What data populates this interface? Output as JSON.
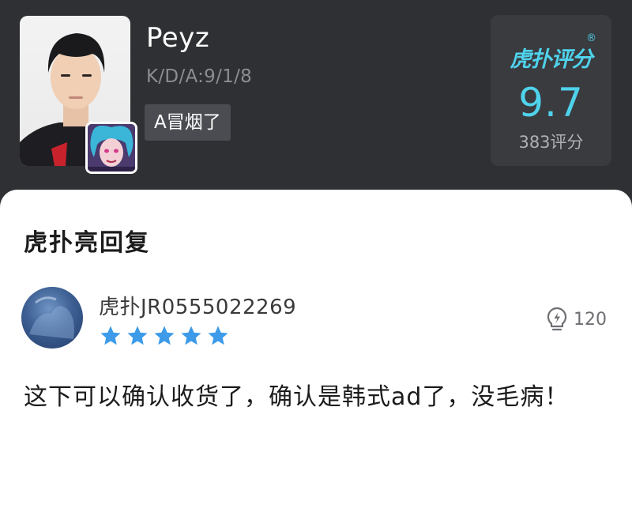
{
  "player": {
    "name": "Peyz",
    "kda": "K/D/A:9/1/8",
    "tag": "A冒烟了"
  },
  "rating": {
    "brand": "虎扑评分",
    "registered_mark": "®",
    "score": "9.7",
    "count": "383评分",
    "accent_color": "#4fd3ec"
  },
  "section": {
    "title": "虎扑亮回复"
  },
  "reply": {
    "username": "虎扑JR0555022269",
    "stars": 5,
    "star_color": "#3d9be9",
    "likes_icon": "lightbulb-icon",
    "likes": "120",
    "text": "这下可以确认收货了，确认是韩式ad了，没毛病！"
  }
}
